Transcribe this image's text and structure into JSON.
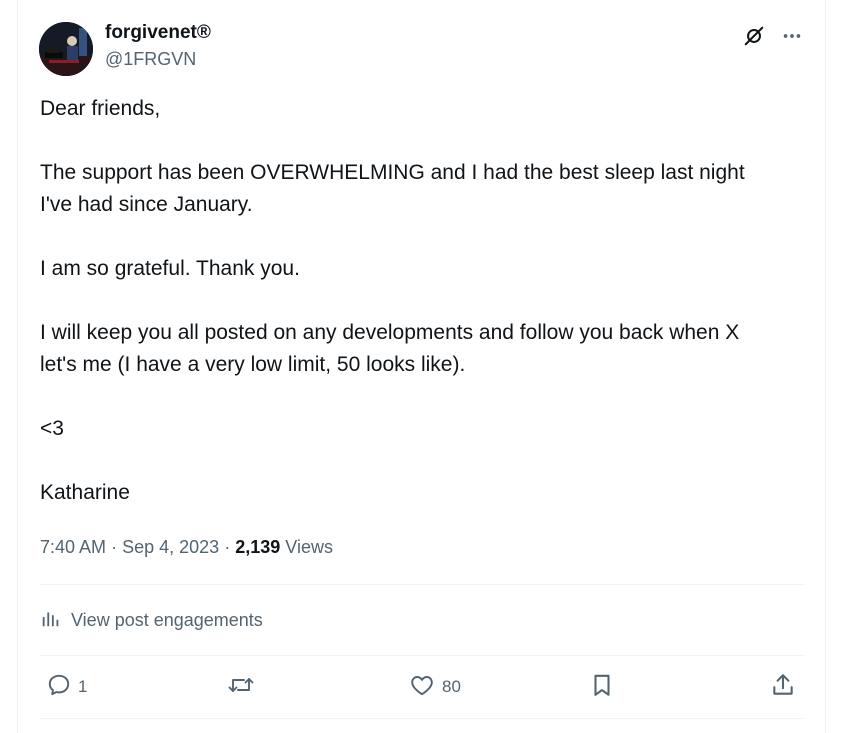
{
  "author": {
    "display_name": "forgivenet®",
    "handle": "@1FRGVN"
  },
  "header_icons": [
    "grok-icon",
    "more-icon"
  ],
  "post": {
    "paragraphs": [
      "Dear friends,",
      "The support has been OVERWHELMING and I had the best sleep last night I've had since January.",
      "I am so grateful. Thank you.",
      "I will keep you all posted on any developments and follow you back when X let's me (I have a very low limit, 50 looks like).",
      "<3",
      "Katharine"
    ]
  },
  "meta": {
    "time": "7:40 AM",
    "separator": "·",
    "date": "Sep 4, 2023",
    "views_count": "2,139",
    "views_label": "Views"
  },
  "engagements": {
    "label": "View post engagements"
  },
  "actions": {
    "reply_count": "1",
    "like_count": "80"
  },
  "colors": {
    "text": "#0f1419",
    "muted": "#536471",
    "divider": "#eff3f4"
  }
}
